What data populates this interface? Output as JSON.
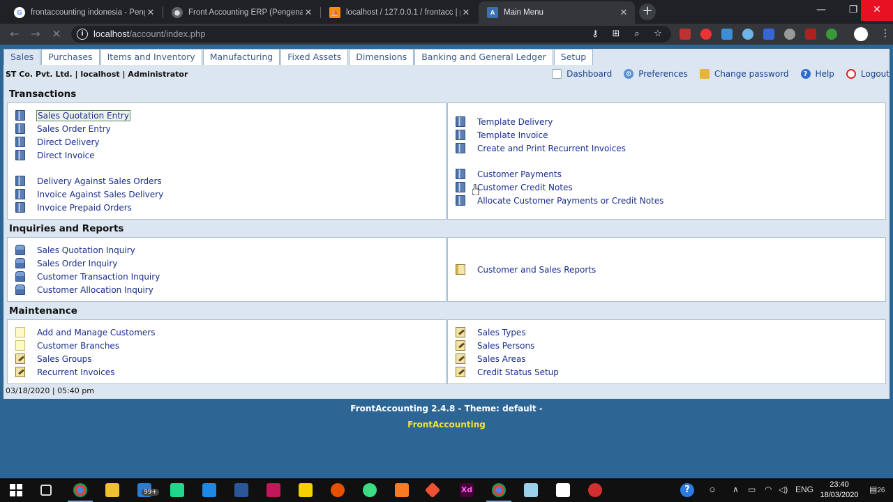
{
  "browser": {
    "tabs": [
      {
        "title": "frontaccounting indonesia - Peng",
        "active": false
      },
      {
        "title": "Front Accounting ERP (Pengenala",
        "active": false
      },
      {
        "title": "localhost / 127.0.0.1 / frontacc | p",
        "active": false
      },
      {
        "title": "Main Menu",
        "active": true
      }
    ],
    "url_host": "localhost",
    "url_path": "/account/index.php"
  },
  "app": {
    "menu": [
      "Sales",
      "Purchases",
      "Items and Inventory",
      "Manufacturing",
      "Fixed Assets",
      "Dimensions",
      "Banking and General Ledger",
      "Setup"
    ],
    "selected_menu": "Sales",
    "company_line": "ST Co. Pvt. Ltd. | localhost | Administrator",
    "toplinks": [
      "Dashboard",
      "Preferences",
      "Change password",
      "Help",
      "Logout"
    ],
    "sections": {
      "transactions": {
        "title": "Transactions",
        "left": [
          "Sales Quotation Entry",
          "Sales Order Entry",
          "Direct Delivery",
          "Direct Invoice",
          "Delivery Against Sales Orders",
          "Invoice Against Sales Delivery",
          "Invoice Prepaid Orders"
        ],
        "right": [
          "Template Delivery",
          "Template Invoice",
          "Create and Print Recurrent Invoices",
          "Customer Payments",
          "Customer Credit Notes",
          "Allocate Customer Payments or Credit Notes"
        ]
      },
      "inquiries": {
        "title": "Inquiries and Reports",
        "left": [
          "Sales Quotation Inquiry",
          "Sales Order Inquiry",
          "Customer Transaction Inquiry",
          "Customer Allocation Inquiry"
        ],
        "right": [
          "Customer and Sales Reports"
        ]
      },
      "maintenance": {
        "title": "Maintenance",
        "left": [
          "Add and Manage Customers",
          "Customer Branches",
          "Sales Groups",
          "Recurrent Invoices"
        ],
        "right": [
          "Sales Types",
          "Sales Persons",
          "Sales Areas",
          "Credit Status Setup"
        ]
      }
    },
    "status_datetime": "03/18/2020 | 05:40 pm",
    "footer_version": "FrontAccounting 2.4.8 - Theme: default -",
    "footer_link": "FrontAccounting"
  },
  "taskbar": {
    "badge": "99+",
    "lang": "ENG",
    "time": "23:40",
    "date": "18/03/2020",
    "notif_count": "26"
  }
}
